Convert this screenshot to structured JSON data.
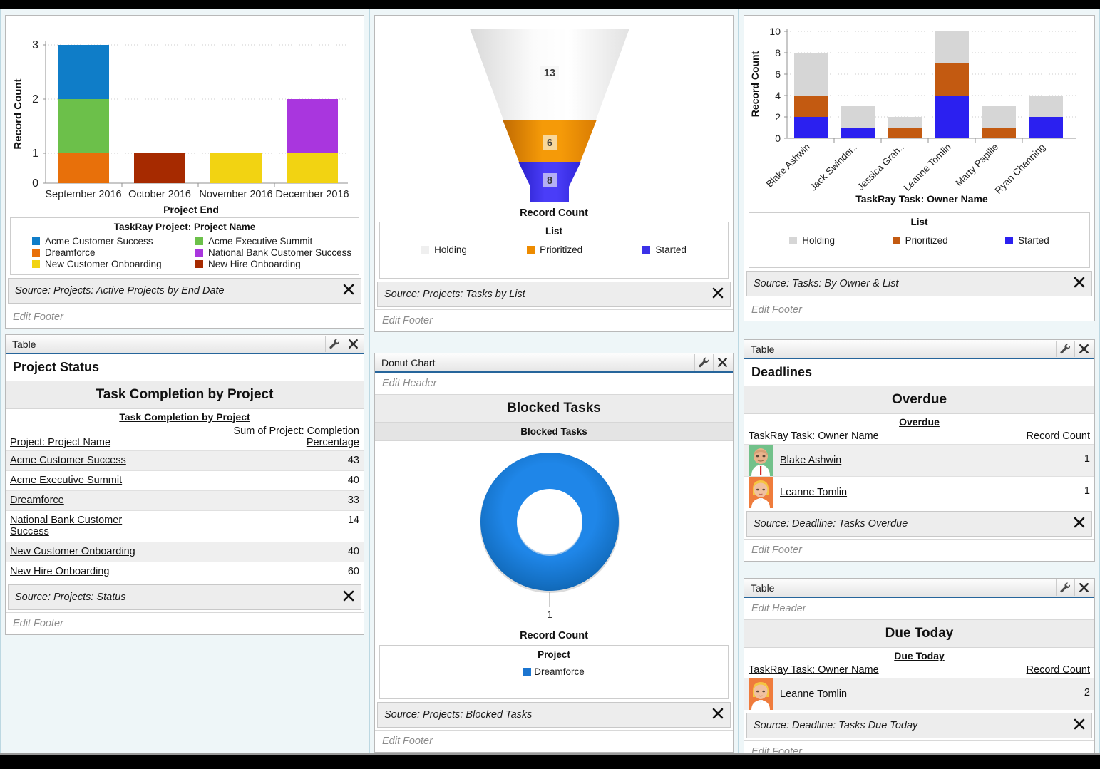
{
  "columns": {
    "left": {
      "chart_component": {
        "source": "Source: Projects: Active Projects by End Date",
        "footer_placeholder": "Edit Footer"
      },
      "table_component": {
        "panel_title": "Table",
        "header": "Project Status",
        "report_title": "Task Completion by Project",
        "group_title": "Task Completion by Project",
        "col_name": "Project: Project Name",
        "col_value": "Sum of Project: Completion Percentage",
        "rows": [
          {
            "name": "Acme Customer Success",
            "value": "43"
          },
          {
            "name": "Acme Executive Summit",
            "value": "40"
          },
          {
            "name": "Dreamforce",
            "value": "33"
          },
          {
            "name": "National Bank Customer Success",
            "value": "14"
          },
          {
            "name": "New Customer Onboarding",
            "value": "40"
          },
          {
            "name": "New Hire Onboarding",
            "value": "60"
          }
        ],
        "source": "Source: Projects: Status",
        "footer_placeholder": "Edit Footer"
      }
    },
    "middle": {
      "funnel_component": {
        "source": "Source: Projects: Tasks by List",
        "footer_placeholder": "Edit Footer"
      },
      "donut_component": {
        "panel_title": "Donut Chart",
        "header_placeholder": "Edit Header",
        "report_title": "Blocked Tasks",
        "chart_subtitle": "Blocked Tasks",
        "source": "Source: Projects: Blocked Tasks",
        "footer_placeholder": "Edit Footer"
      }
    },
    "right": {
      "chart_component": {
        "source": "Source: Tasks: By Owner & List",
        "footer_placeholder": "Edit Footer"
      },
      "overdue_component": {
        "panel_title": "Table",
        "header": "Deadlines",
        "report_title": "Overdue",
        "group_title": "Overdue",
        "col_name": "TaskRay Task: Owner Name",
        "col_value": "Record Count",
        "rows": [
          {
            "name": "Blake Ashwin",
            "value": "1",
            "avatar": "avatar-blake"
          },
          {
            "name": "Leanne Tomlin",
            "value": "1",
            "avatar": "avatar-leanne"
          }
        ],
        "source": "Source: Deadline: Tasks Overdue",
        "footer_placeholder": "Edit Footer"
      },
      "duetoday_component": {
        "panel_title": "Table",
        "header_placeholder": "Edit Header",
        "report_title": "Due Today",
        "group_title": "Due Today",
        "col_name": "TaskRay Task: Owner Name",
        "col_value": "Record Count",
        "rows": [
          {
            "name": "Leanne Tomlin",
            "value": "2",
            "avatar": "avatar-leanne"
          }
        ],
        "source": "Source: Deadline: Tasks Due Today",
        "footer_placeholder": "Edit Footer"
      }
    }
  },
  "icons": {
    "wrench": "wrench-icon",
    "close": "close-icon"
  },
  "chart_data": [
    {
      "id": "active-projects-by-end-date",
      "type": "bar",
      "stacked": true,
      "title": "",
      "xlabel": "Project End",
      "ylabel": "Record Count",
      "ylim": [
        0,
        3
      ],
      "yticks": [
        0,
        1,
        2,
        3
      ],
      "grid": true,
      "legend_title": "TaskRay Project: Project Name",
      "legend_position": "bottom",
      "categories": [
        "September 2016",
        "October 2016",
        "November 2016",
        "December 2016"
      ],
      "series": [
        {
          "name": "Acme Customer Success",
          "color": "#0F7DC8",
          "values": [
            1,
            0,
            0,
            0
          ]
        },
        {
          "name": "Acme Executive Summit",
          "color": "#6CC04A",
          "values": [
            1,
            0,
            0,
            0
          ]
        },
        {
          "name": "Dreamforce",
          "color": "#E8700A",
          "values": [
            1,
            0,
            0,
            0
          ]
        },
        {
          "name": "National Bank Customer Success",
          "color": "#A936DE",
          "values": [
            0,
            0,
            0,
            1
          ]
        },
        {
          "name": "New Customer Onboarding",
          "color": "#F2D312",
          "values": [
            0,
            0,
            1,
            1
          ]
        },
        {
          "name": "New Hire Onboarding",
          "color": "#A62A00",
          "values": [
            0,
            1,
            0,
            0
          ]
        }
      ],
      "totals": [
        3,
        1,
        1,
        2
      ]
    },
    {
      "id": "tasks-by-list",
      "type": "funnel",
      "xlabel": "Record Count",
      "legend_title": "List",
      "legend_position": "bottom",
      "categories": [
        "Holding",
        "Prioritized",
        "Started"
      ],
      "values": [
        13,
        6,
        8
      ],
      "colors": [
        "#EFEFEF",
        "#ED8B00",
        "#3B32E8"
      ]
    },
    {
      "id": "tasks-by-owner-and-list",
      "type": "bar",
      "stacked": true,
      "xlabel": "TaskRay Task: Owner Name",
      "ylabel": "Record Count",
      "ylim": [
        0,
        10
      ],
      "yticks": [
        0,
        2,
        4,
        6,
        8,
        10
      ],
      "grid": true,
      "legend_title": "List",
      "legend_position": "bottom",
      "categories": [
        "Blake Ashwin",
        "Jack Swinder..",
        "Jessica Grah..",
        "Leanne Tomlin",
        "Marty Papille",
        "Ryan Channing"
      ],
      "series": [
        {
          "name": "Started",
          "color": "#2B20F0",
          "values": [
            2,
            1,
            0,
            4,
            0,
            2
          ]
        },
        {
          "name": "Prioritized",
          "color": "#C35A11",
          "values": [
            2,
            0,
            1,
            3,
            1,
            0
          ]
        },
        {
          "name": "Holding",
          "color": "#D6D6D6",
          "values": [
            4,
            2,
            1,
            3,
            2,
            2
          ]
        }
      ],
      "totals": [
        8,
        3,
        2,
        10,
        3,
        4
      ]
    },
    {
      "id": "blocked-tasks",
      "type": "pie",
      "donut": true,
      "xlabel": "Record Count",
      "legend_title": "Project",
      "legend_position": "bottom",
      "categories": [
        "Dreamforce"
      ],
      "values": [
        1
      ],
      "colors": [
        "#1B75D0"
      ],
      "data_labels": [
        "1"
      ]
    }
  ]
}
